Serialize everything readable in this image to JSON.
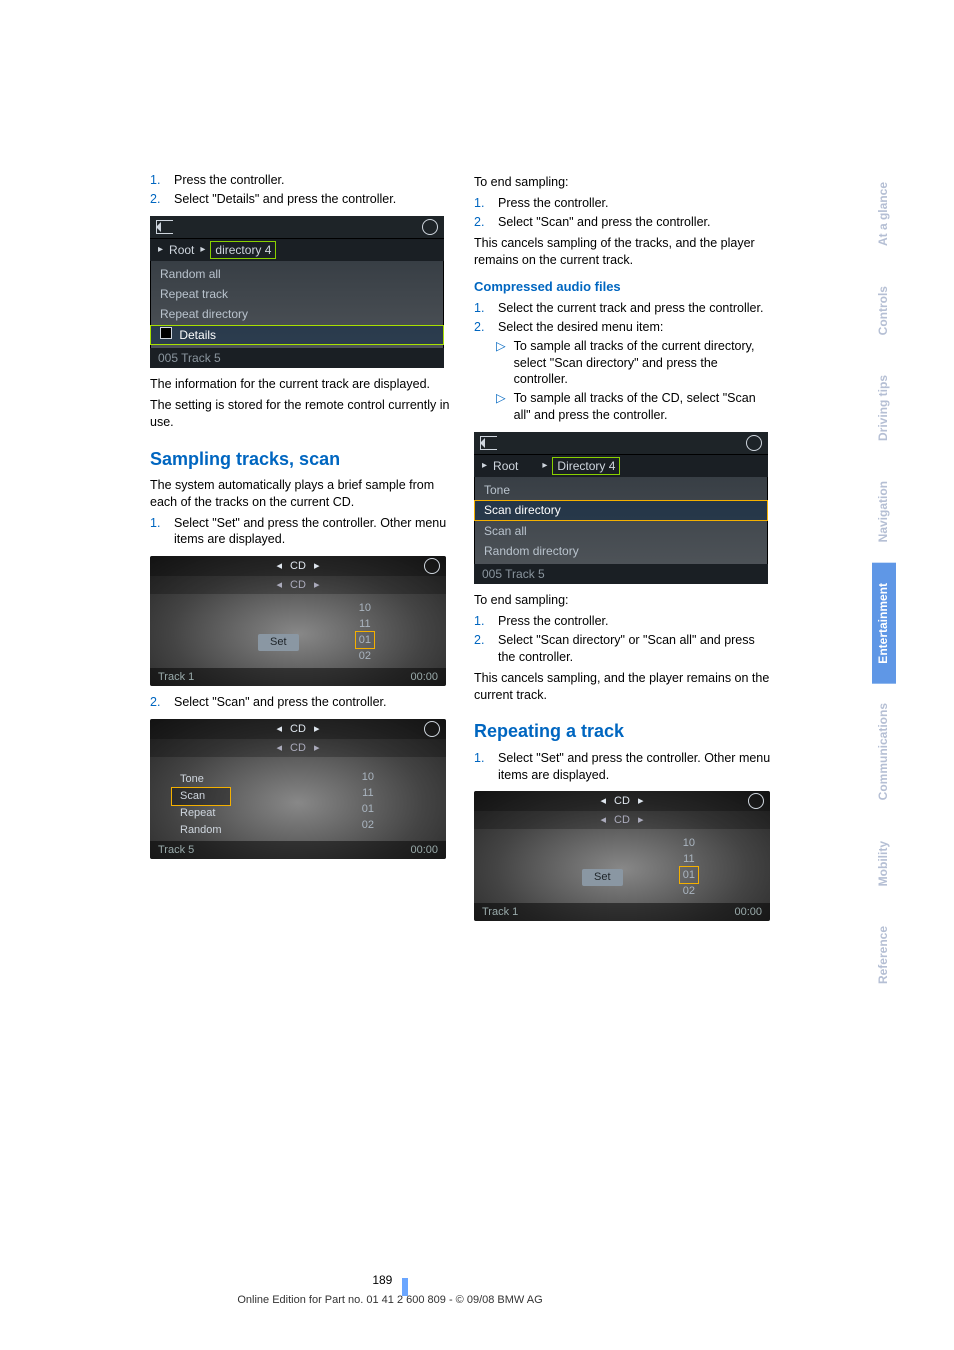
{
  "left": {
    "steps_top": [
      {
        "n": "1.",
        "t": "Press the controller."
      },
      {
        "n": "2.",
        "t": "Select \"Details\" and press the controller."
      }
    ],
    "shot1": {
      "crumb_root": "Root",
      "crumb_dir": "directory 4",
      "rows": [
        "Random all",
        "Repeat track",
        "Repeat directory"
      ],
      "sel_row": "Details",
      "footer": "005 Track 5"
    },
    "after_shot1_p1": "The information for the current track are displayed.",
    "after_shot1_p2": "The setting is stored for the remote control currently in use.",
    "h2": "Sampling tracks, scan",
    "h2_p": "The system automatically plays a brief sample from each of the tracks on the current CD.",
    "step_set": {
      "n": "1.",
      "t": "Select \"Set\" and press the controller. Other menu items are displayed."
    },
    "cd1": {
      "top": "CD",
      "top2": "CD",
      "nums": [
        "10",
        "11",
        "01",
        "02"
      ],
      "btn": "Set",
      "foot_l": "Track 1",
      "foot_r": "00:00"
    },
    "step_scan": {
      "n": "2.",
      "t": "Select \"Scan\" and press the controller."
    },
    "cd2": {
      "top": "CD",
      "top2": "CD",
      "menu": [
        "Tone",
        "Scan",
        "Repeat",
        "Random"
      ],
      "nums": [
        "10",
        "11",
        "01",
        "02"
      ],
      "foot_l": "Track 5",
      "foot_r": "00:00"
    }
  },
  "right": {
    "end1_intro": "To end sampling:",
    "end1_steps": [
      {
        "n": "1.",
        "t": "Press the controller."
      },
      {
        "n": "2.",
        "t": "Select \"Scan\" and press the controller."
      }
    ],
    "end1_out": "This cancels sampling of the tracks, and the player remains on the current track.",
    "h3": "Compressed audio files",
    "comp_steps": [
      {
        "n": "1.",
        "t": "Select the current track and press the controller."
      },
      {
        "n": "2.",
        "t": "Select the desired menu item:"
      }
    ],
    "comp_sub": [
      "To sample all tracks of the current directory, select \"Scan directory\" and press the controller.",
      "To sample all tracks of the CD, select \"Scan all\" and press the controller."
    ],
    "shot2": {
      "crumb_root": "Root",
      "crumb_dir": "Directory 4",
      "rows_pre": [
        "Tone"
      ],
      "sel_row": "Scan directory",
      "rows_post": [
        "Scan all",
        "Random directory"
      ],
      "footer": "005 Track 5"
    },
    "end2_intro": "To end sampling:",
    "end2_steps": [
      {
        "n": "1.",
        "t": "Press the controller."
      },
      {
        "n": "2.",
        "t": "Select \"Scan directory\" or \"Scan all\" and press the controller."
      }
    ],
    "end2_out": "This cancels sampling, and the player remains on the current track.",
    "h2b": "Repeating a track",
    "rep_step": {
      "n": "1.",
      "t": "Select \"Set\" and press the controller. Other menu items are displayed."
    },
    "cd3": {
      "top": "CD",
      "top2": "CD",
      "nums": [
        "10",
        "11",
        "01",
        "02"
      ],
      "btn": "Set",
      "foot_l": "Track 1",
      "foot_r": "00:00"
    }
  },
  "tabs": [
    "Reference",
    "Mobility",
    "Communications",
    "Entertainment",
    "Navigation",
    "Driving tips",
    "Controls",
    "At a glance"
  ],
  "active_tab": "Entertainment",
  "page_number": "189",
  "footer_line": "Online Edition for Part no. 01 41 2 600 809 - © 09/08 BMW AG"
}
